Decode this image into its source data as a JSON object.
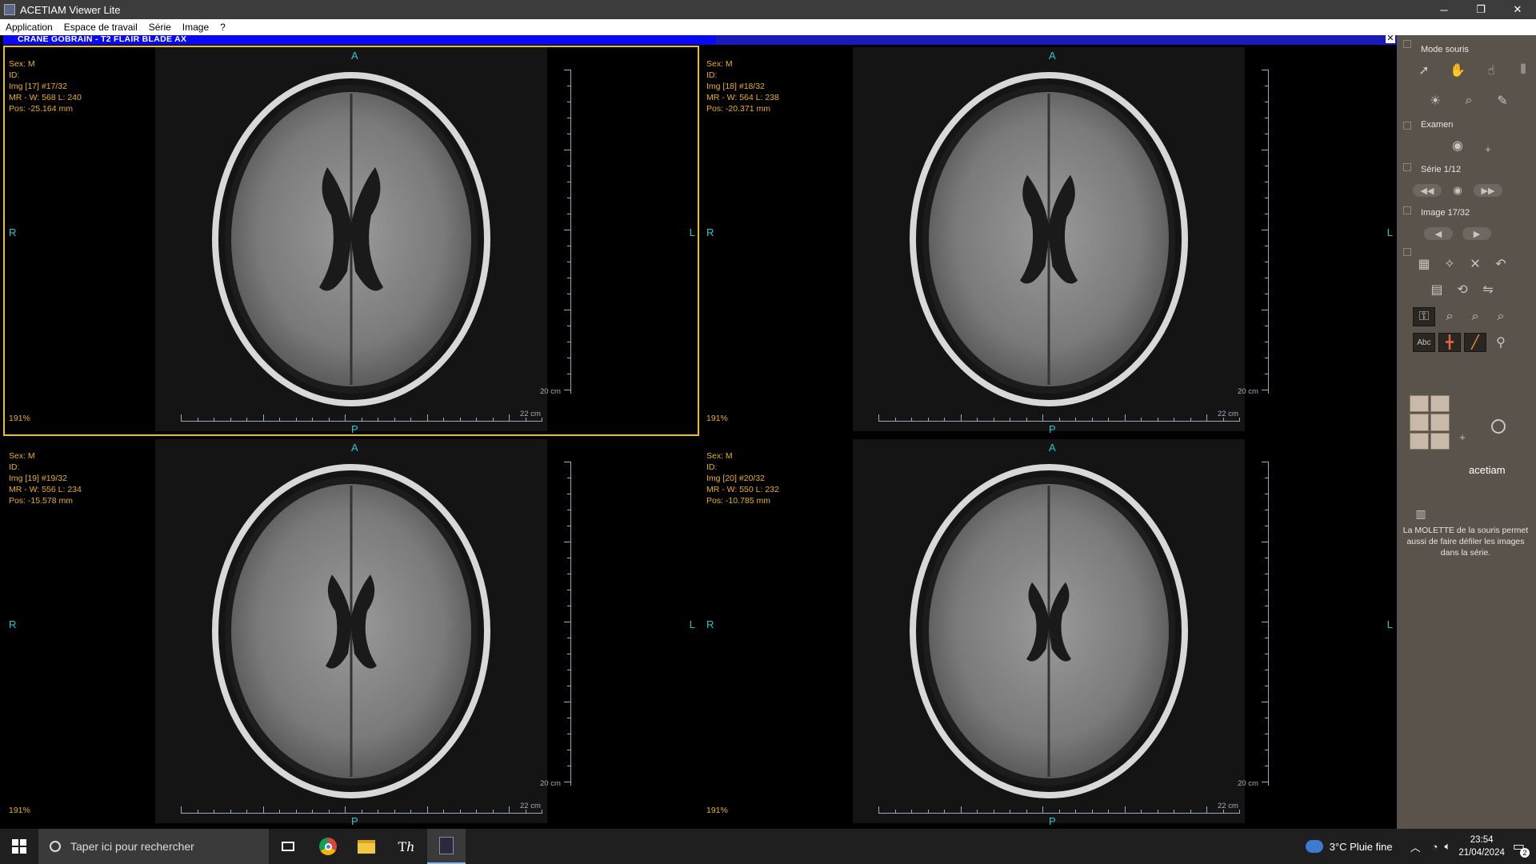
{
  "window": {
    "title": "ACETIAM Viewer Lite",
    "minimize": "─",
    "restore": "❐",
    "close": "✕"
  },
  "menu": [
    "Application",
    "Espace de travail",
    "Série",
    "Image",
    "?"
  ],
  "series": {
    "title": "CRANE GOBRAIN  - T2 FLAIR BLADE AX",
    "close": "✕"
  },
  "viewports": [
    {
      "sex": "Sex: M",
      "id": "ID:",
      "img": "Img [17]  #17/32",
      "wl": "MR - W: 568 L: 240",
      "pos": "Pos: -25.164 mm",
      "zoom": "191%",
      "active": true
    },
    {
      "sex": "Sex: M",
      "id": "ID:",
      "img": "Img [18]  #18/32",
      "wl": "MR - W: 564 L: 238",
      "pos": "Pos: -20.371 mm",
      "zoom": "191%",
      "active": false
    },
    {
      "sex": "Sex: M",
      "id": "ID:",
      "img": "Img [19]  #19/32",
      "wl": "MR - W: 556 L: 234",
      "pos": "Pos: -15.578 mm",
      "zoom": "191%",
      "active": false
    },
    {
      "sex": "Sex: M",
      "id": "ID:",
      "img": "Img [20]  #20/32",
      "wl": "MR - W: 550 L: 232",
      "pos": "Pos: -10.785 mm",
      "zoom": "191%",
      "active": false
    }
  ],
  "orientation": {
    "top": "A",
    "bottom": "P",
    "left": "R",
    "right": "L"
  },
  "scale": {
    "vertical": "20 cm",
    "horizontal": "22 cm"
  },
  "panel": {
    "mode_label": "Mode souris",
    "exam_label": "Examen",
    "series_label": "Série 1/12",
    "image_label": "Image 17/32",
    "logo": "acetiam",
    "hint": "La MOLETTE de la souris permet aussi de faire défiler les images dans la série.",
    "plus": "+"
  },
  "taskbar": {
    "search_placeholder": "Taper ici pour rechercher",
    "weather": "3°C  Pluie fine",
    "time": "23:54",
    "date": "21/04/2024",
    "notif_count": "2"
  },
  "colors": {
    "overlay_text": "#e8b020",
    "orientation_text": "#2ec6c8",
    "active_border": "#e8c21c",
    "series_bar": "#1a1ab8",
    "panel_bg": "#5a534c"
  }
}
